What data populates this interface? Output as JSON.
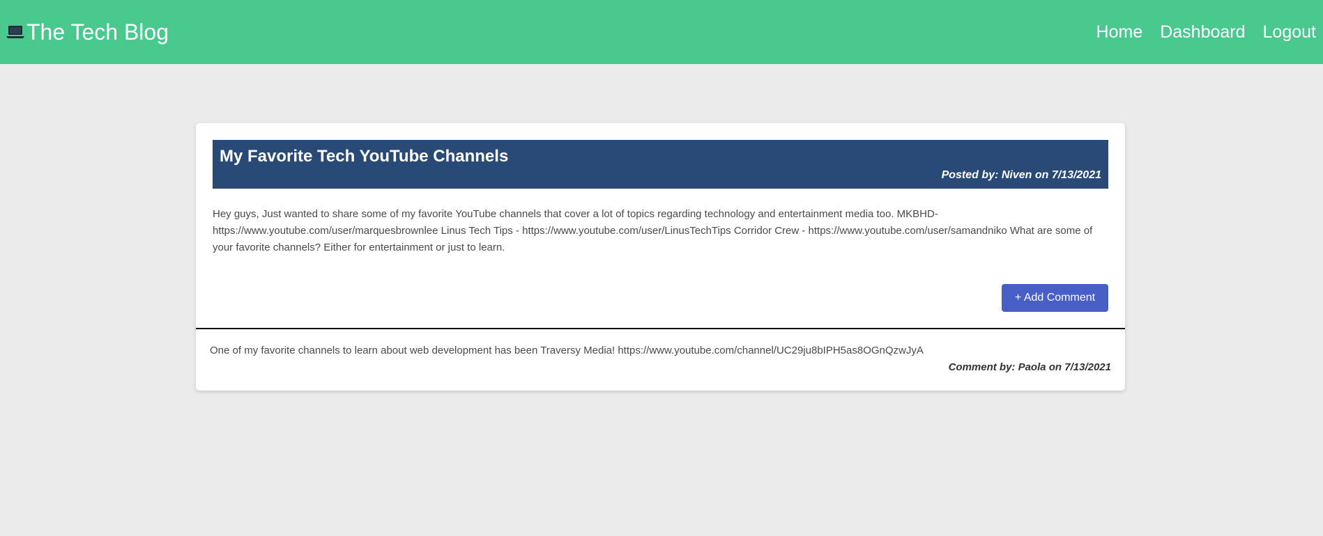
{
  "navbar": {
    "brand_icon": "laptop-icon",
    "brand_title": "The Tech Blog",
    "links": [
      {
        "label": "Home"
      },
      {
        "label": "Dashboard"
      },
      {
        "label": "Logout"
      }
    ],
    "background_color": "#4ac98f"
  },
  "post": {
    "title": "My Favorite Tech YouTube Channels",
    "meta": "Posted by: Niven on 7/13/2021",
    "body": "Hey guys, Just wanted to share some of my favorite YouTube channels that cover a lot of topics regarding technology and entertainment media too. MKBHD- https://www.youtube.com/user/marquesbrownlee Linus Tech Tips - https://www.youtube.com/user/LinusTechTips Corridor Crew - https://www.youtube.com/user/samandniko What are some of your favorite channels? Either for entertainment or just to learn.",
    "header_color": "#294a77",
    "add_comment_label": "+ Add Comment",
    "button_color": "#485fc7"
  },
  "comments": [
    {
      "text": "One of my favorite channels to learn about web development has been Traversy Media! https://www.youtube.com/channel/UC29ju8bIPH5as8OGnQzwJyA",
      "meta": "Comment by: Paola on 7/13/2021"
    }
  ]
}
